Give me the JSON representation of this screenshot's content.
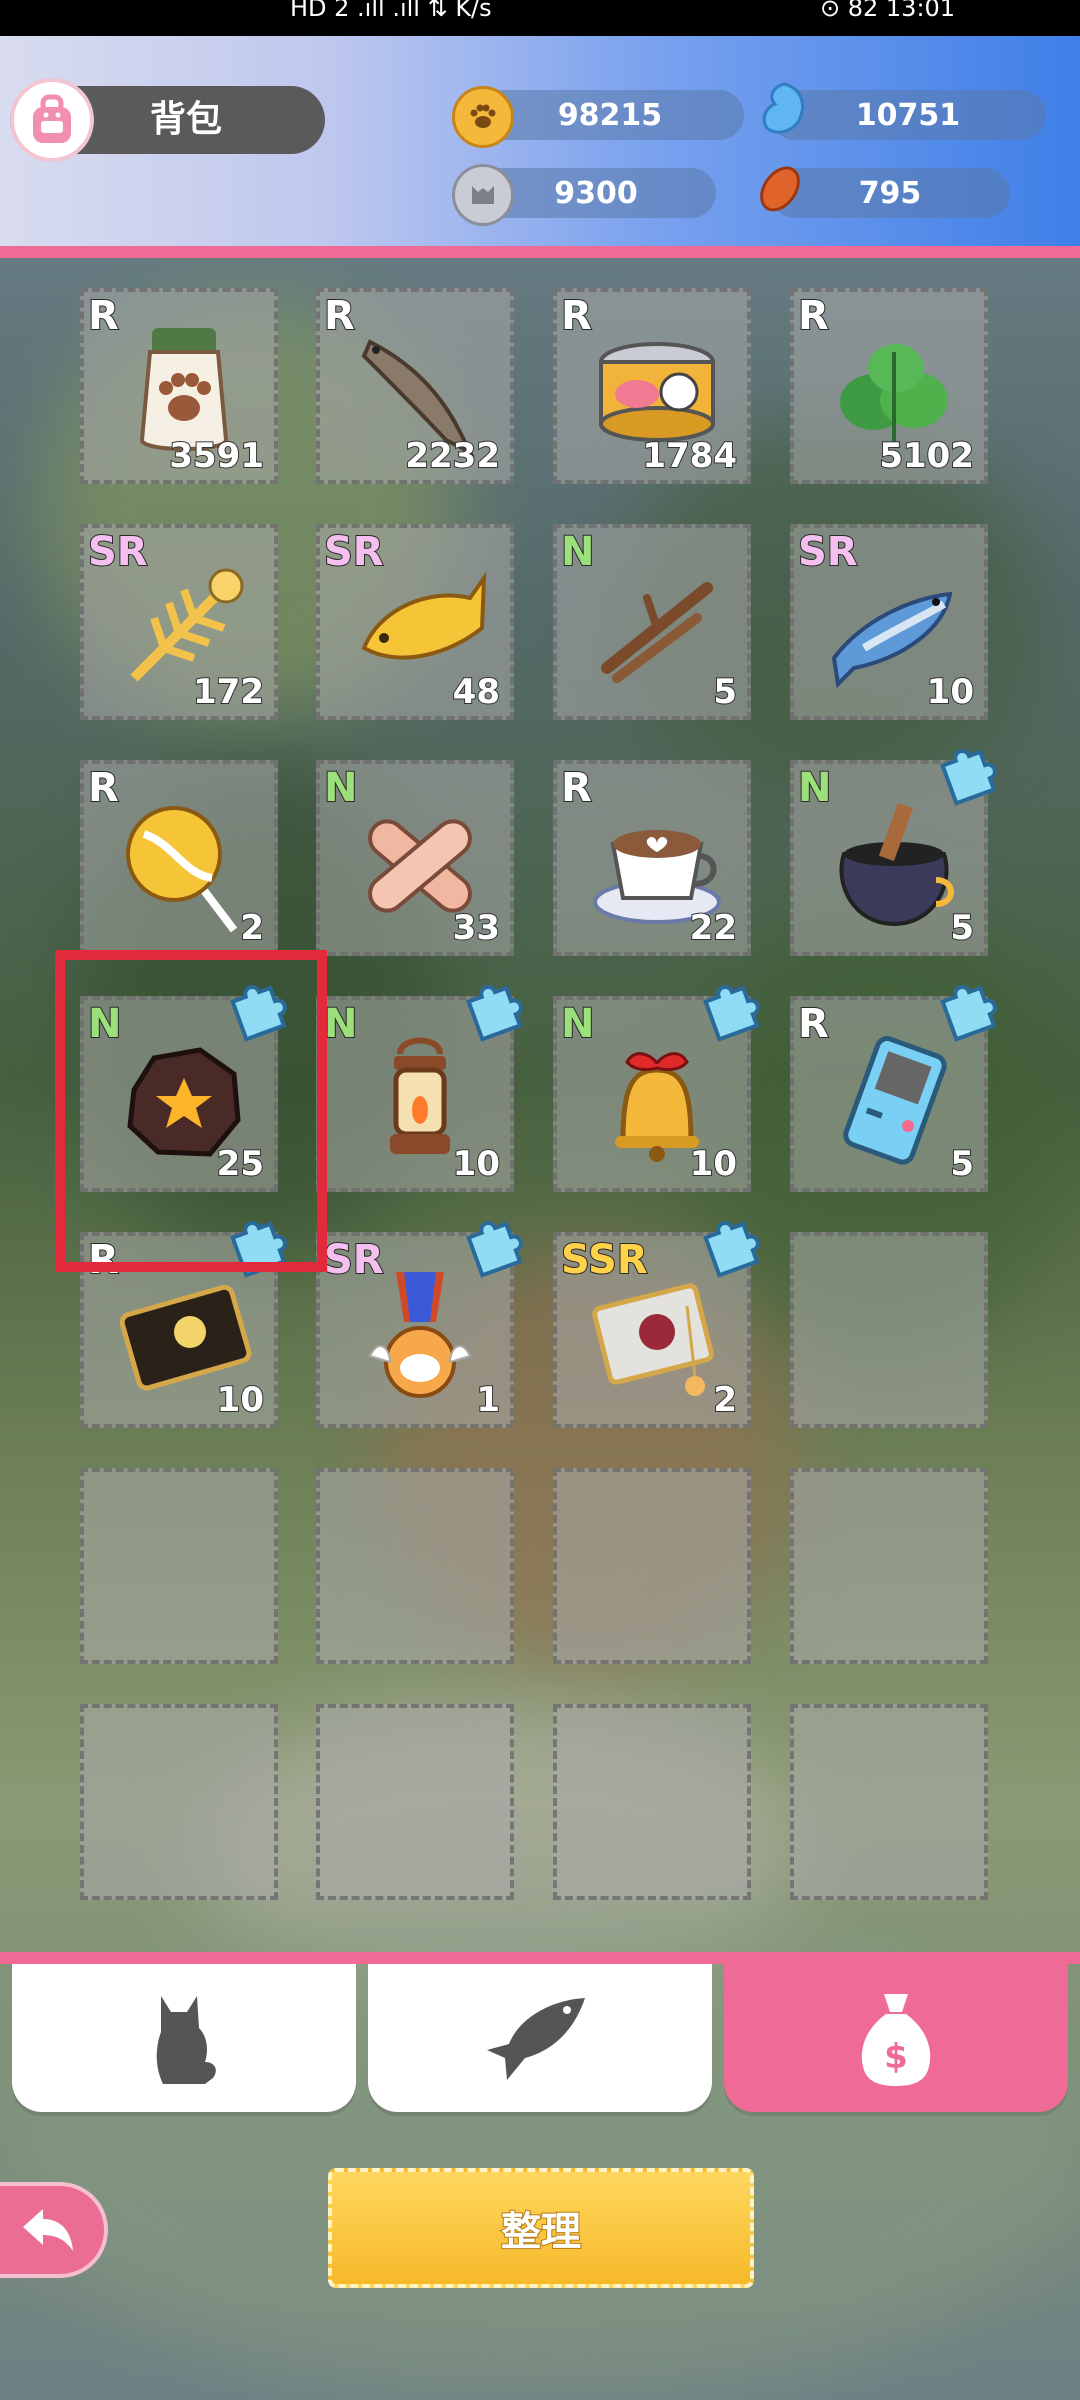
{
  "status_bar": {
    "left": "HD 2  .ıll  .ıll  ⇅ K/s",
    "right": "⊙ 82 13:01"
  },
  "header": {
    "title": "背包",
    "resources": [
      {
        "icon": "paw-coin-icon",
        "value": "98215"
      },
      {
        "icon": "fish-currency-icon",
        "value": "10751"
      },
      {
        "icon": "cat-badge-icon",
        "value": "9300"
      },
      {
        "icon": "bean-icon",
        "value": "795"
      }
    ]
  },
  "inventory": [
    {
      "rarity": "R",
      "count": "3591",
      "icon": "cat-food-bag-icon"
    },
    {
      "rarity": "R",
      "count": "2232",
      "icon": "dried-fish-icon"
    },
    {
      "rarity": "R",
      "count": "1784",
      "icon": "cat-can-icon"
    },
    {
      "rarity": "R",
      "count": "5102",
      "icon": "mint-leaves-icon"
    },
    {
      "rarity": "SR",
      "count": "172",
      "icon": "fish-bone-icon"
    },
    {
      "rarity": "SR",
      "count": "48",
      "icon": "golden-fish-icon"
    },
    {
      "rarity": "N",
      "count": "5",
      "icon": "twigs-icon"
    },
    {
      "rarity": "SR",
      "count": "10",
      "icon": "mackerel-icon"
    },
    {
      "rarity": "R",
      "count": "2",
      "icon": "lollipop-icon"
    },
    {
      "rarity": "N",
      "count": "33",
      "icon": "bandage-icon"
    },
    {
      "rarity": "R",
      "count": "22",
      "icon": "latte-icon"
    },
    {
      "rarity": "N",
      "count": "5",
      "icon": "cauldron-icon",
      "puzzle": true
    },
    {
      "rarity": "N",
      "count": "25",
      "icon": "meteor-rock-icon",
      "puzzle": true
    },
    {
      "rarity": "N",
      "count": "10",
      "icon": "lantern-icon",
      "puzzle": true
    },
    {
      "rarity": "N",
      "count": "10",
      "icon": "bell-icon",
      "puzzle": true
    },
    {
      "rarity": "R",
      "count": "5",
      "icon": "game-console-icon",
      "puzzle": true
    },
    {
      "rarity": "R",
      "count": "10",
      "icon": "black-card-icon",
      "puzzle": true
    },
    {
      "rarity": "SR",
      "count": "1",
      "icon": "cat-medal-icon",
      "puzzle": true
    },
    {
      "rarity": "SSR",
      "count": "2",
      "icon": "photo-charm-icon",
      "puzzle": true
    },
    {},
    {},
    {},
    {},
    {},
    {},
    {},
    {},
    {}
  ],
  "tabs": [
    {
      "icon": "cat-silhouette-icon",
      "active": false
    },
    {
      "icon": "fish-silhouette-icon",
      "active": false
    },
    {
      "icon": "money-bag-icon",
      "active": true
    }
  ],
  "back_button": {
    "icon": "back-arrow-icon"
  },
  "sort_button": {
    "label": "整理"
  }
}
